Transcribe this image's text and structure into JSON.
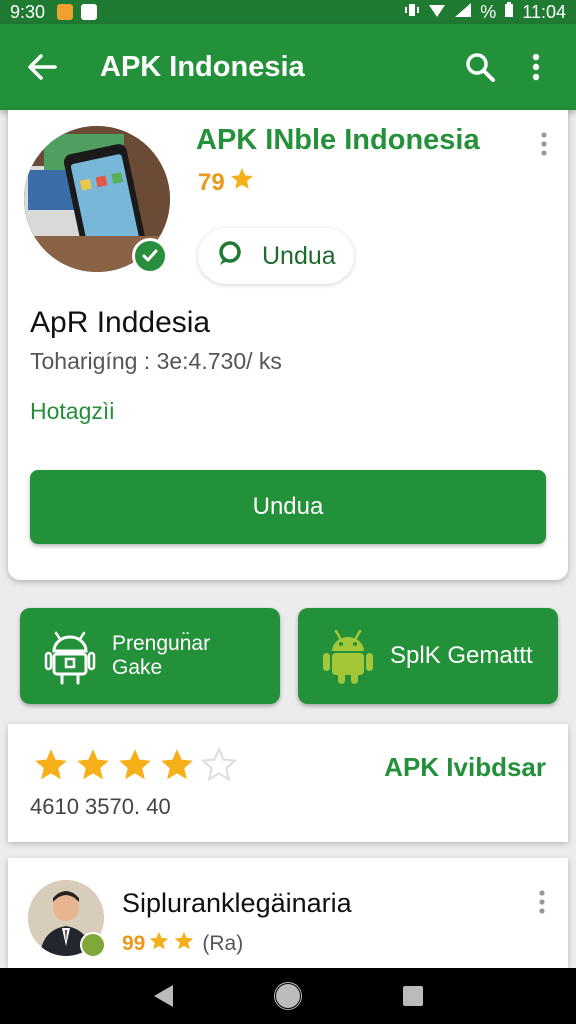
{
  "status_bar": {
    "time": "9:30",
    "right_time": "11:04",
    "battery_text": "%"
  },
  "app_bar": {
    "title": "APK Indonesia"
  },
  "app_card": {
    "title": "APK INble Indonesia",
    "rating": "79",
    "chip_label": "Undua",
    "name": "ApR Inddesia",
    "meta": "Toharigíng : 3e:4.730/ ks",
    "link": "Hotagzìi",
    "primary_button": "Undua"
  },
  "tiles": [
    {
      "label_line1": "Prengun̈ar",
      "label_line2": "Gake"
    },
    {
      "label": "SplK Gemattt"
    }
  ],
  "rating_card": {
    "stars_filled": 4,
    "stars_total": 5,
    "count": "4610 3570. 40",
    "brand": "APK Ivibdsar"
  },
  "review_card": {
    "name": "Siplurankle​gäinaria",
    "rating": "99",
    "rating_suffix": "(Ra)"
  },
  "colors": {
    "primary": "#23913a",
    "star": "#f5b01a",
    "accent_text": "#24913a"
  }
}
